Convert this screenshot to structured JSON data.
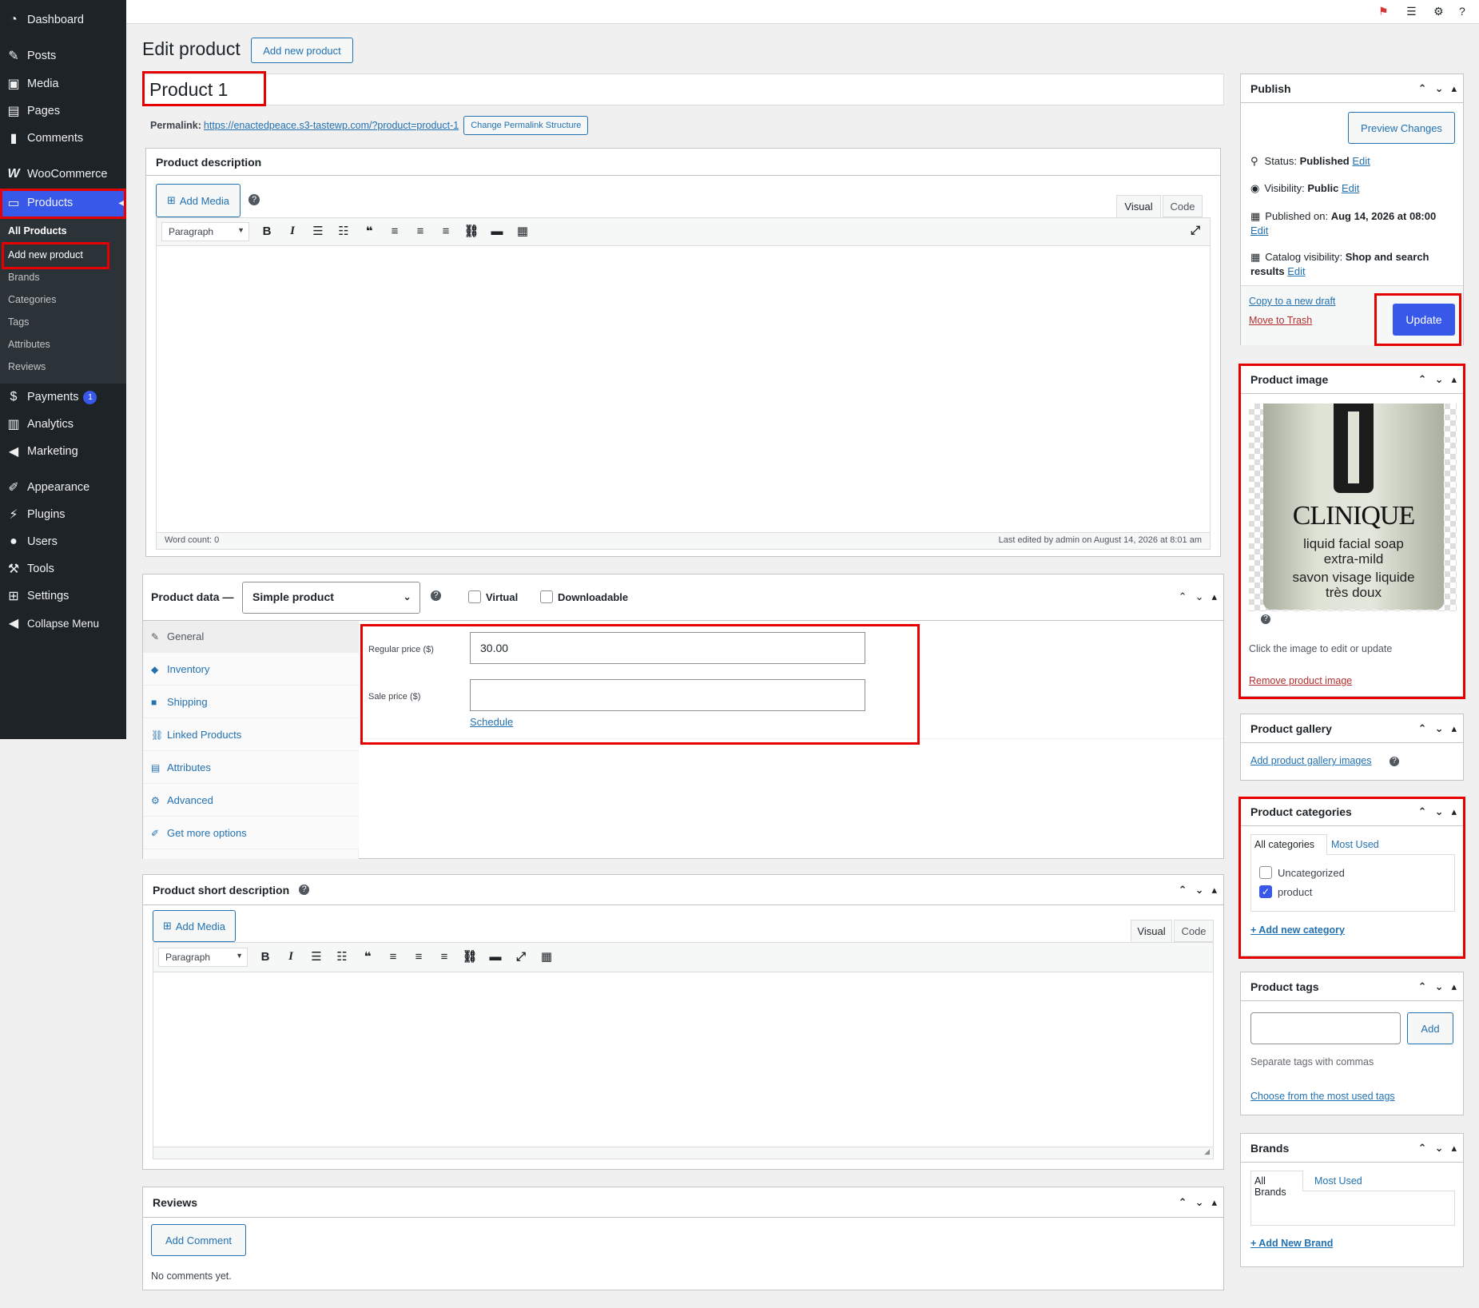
{
  "sidebar": {
    "items": [
      {
        "label": "Dashboard",
        "icon": "dashboard-icon"
      },
      {
        "label": "Posts",
        "icon": "pin-icon"
      },
      {
        "label": "Media",
        "icon": "media-icon"
      },
      {
        "label": "Pages",
        "icon": "pages-icon"
      },
      {
        "label": "Comments",
        "icon": "comments-icon"
      },
      {
        "label": "WooCommerce",
        "icon": "woocommerce-icon"
      },
      {
        "label": "Products",
        "icon": "archive-icon"
      },
      {
        "label": "Payments",
        "icon": "payments-icon",
        "badge": "1"
      },
      {
        "label": "Analytics",
        "icon": "analytics-icon"
      },
      {
        "label": "Marketing",
        "icon": "megaphone-icon"
      },
      {
        "label": "Appearance",
        "icon": "brush-icon"
      },
      {
        "label": "Plugins",
        "icon": "plugin-icon"
      },
      {
        "label": "Users",
        "icon": "user-icon"
      },
      {
        "label": "Tools",
        "icon": "wrench-icon"
      },
      {
        "label": "Settings",
        "icon": "settings-icon"
      },
      {
        "label": "Collapse Menu",
        "icon": "collapse-icon"
      }
    ],
    "submenu": [
      "All Products",
      "Add new product",
      "Brands",
      "Categories",
      "Tags",
      "Attributes",
      "Reviews"
    ]
  },
  "page": {
    "title": "Edit product",
    "add_new_label": "Add new product",
    "product_title": "Product 1",
    "permalink_label": "Permalink:",
    "permalink_url": "https://enactedpeace.s3-tastewp.com/?product=product-1",
    "change_permalink_label": "Change Permalink Structure"
  },
  "description": {
    "heading": "Product description",
    "add_media": "Add Media",
    "tab_visual": "Visual",
    "tab_code": "Code",
    "format_select": "Paragraph",
    "word_count": "Word count: 0",
    "last_edited": "Last edited by admin on August 14, 2026 at 8:01 am"
  },
  "product_data": {
    "heading": "Product data —",
    "type_select": "Simple product",
    "virtual_label": "Virtual",
    "downloadable_label": "Downloadable",
    "tabs": [
      "General",
      "Inventory",
      "Shipping",
      "Linked Products",
      "Attributes",
      "Advanced",
      "Get more options"
    ],
    "regular_price_label": "Regular price ($)",
    "regular_price_value": "30.00",
    "sale_price_label": "Sale price ($)",
    "sale_price_value": "",
    "schedule_label": "Schedule"
  },
  "short_description": {
    "heading": "Product short description",
    "add_media": "Add Media",
    "tab_visual": "Visual",
    "tab_code": "Code",
    "format_select": "Paragraph"
  },
  "reviews": {
    "heading": "Reviews",
    "add_comment": "Add Comment",
    "empty_text": "No comments yet."
  },
  "publish": {
    "heading": "Publish",
    "preview_label": "Preview Changes",
    "status_label": "Status:",
    "status_value": "Published",
    "visibility_label": "Visibility:",
    "visibility_value": "Public",
    "published_on_label": "Published on:",
    "published_on_value": "Aug 14, 2026 at 08:00",
    "catalog_label": "Catalog visibility:",
    "catalog_value": "Shop and search results",
    "edit_label": "Edit",
    "copy_draft": "Copy to a new draft",
    "trash": "Move to Trash",
    "update": "Update"
  },
  "product_image": {
    "heading": "Product image",
    "image_lines": [
      "CLINIQUE",
      "liquid facial soap",
      "extra-mild",
      "savon visage liquide",
      "très doux"
    ],
    "hint": "Click the image to edit or update",
    "remove": "Remove product image"
  },
  "gallery": {
    "heading": "Product gallery",
    "add_link": "Add product gallery images"
  },
  "categories": {
    "heading": "Product categories",
    "tab_all": "All categories",
    "tab_most": "Most Used",
    "items": [
      {
        "label": "Uncategorized",
        "checked": false
      },
      {
        "label": "product",
        "checked": true
      }
    ],
    "add_new": "+ Add new category"
  },
  "tags": {
    "heading": "Product tags",
    "input_value": "",
    "add_label": "Add",
    "hint": "Separate tags with commas",
    "choose": "Choose from the most used tags"
  },
  "brands": {
    "heading": "Brands",
    "tab_all": "All Brands",
    "tab_most": "Most Used",
    "add_new": "+ Add New Brand"
  },
  "colors": {
    "accent": "#3858e9",
    "sidebar_bg": "#1d2327",
    "highlight_red": "#e60000",
    "link": "#2271b1",
    "trash": "#b32d2e"
  }
}
